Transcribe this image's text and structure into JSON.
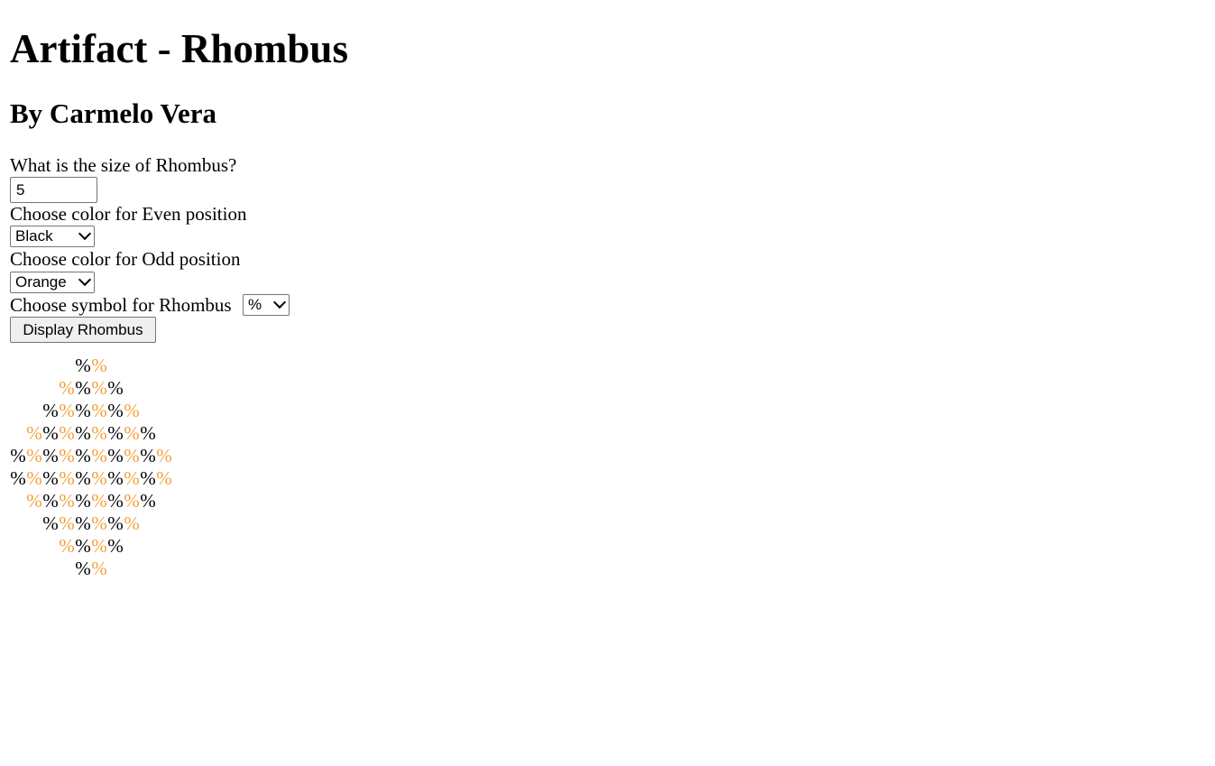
{
  "page": {
    "title": "Artifact - Rhombus",
    "author": "By Carmelo Vera"
  },
  "form": {
    "size_label": "What is the size of Rhombus?",
    "size_value": "5",
    "even_label": "Choose color for Even position",
    "even_value": "Black",
    "odd_label": "Choose color for Odd position",
    "odd_value": "Orange",
    "symbol_label": "Choose symbol for Rhombus",
    "symbol_value": "%",
    "display_button": "Display Rhombus"
  },
  "colors": {
    "even": "#000000",
    "odd": "#f4a03c"
  },
  "rhombus": {
    "symbol": "%",
    "rows": [
      [
        "even",
        "odd"
      ],
      [
        "odd",
        "even",
        "odd",
        "even"
      ],
      [
        "even",
        "odd",
        "even",
        "odd",
        "even",
        "odd"
      ],
      [
        "odd",
        "even",
        "odd",
        "even",
        "odd",
        "even",
        "odd",
        "even"
      ],
      [
        "even",
        "odd",
        "even",
        "odd",
        "even",
        "odd",
        "even",
        "odd",
        "even",
        "odd"
      ],
      [
        "even",
        "odd",
        "even",
        "odd",
        "even",
        "odd",
        "even",
        "odd",
        "even",
        "odd"
      ],
      [
        "odd",
        "even",
        "odd",
        "even",
        "odd",
        "even",
        "odd",
        "even"
      ],
      [
        "even",
        "odd",
        "even",
        "odd",
        "even",
        "odd"
      ],
      [
        "odd",
        "even",
        "odd",
        "even"
      ],
      [
        "even",
        "odd"
      ]
    ]
  }
}
